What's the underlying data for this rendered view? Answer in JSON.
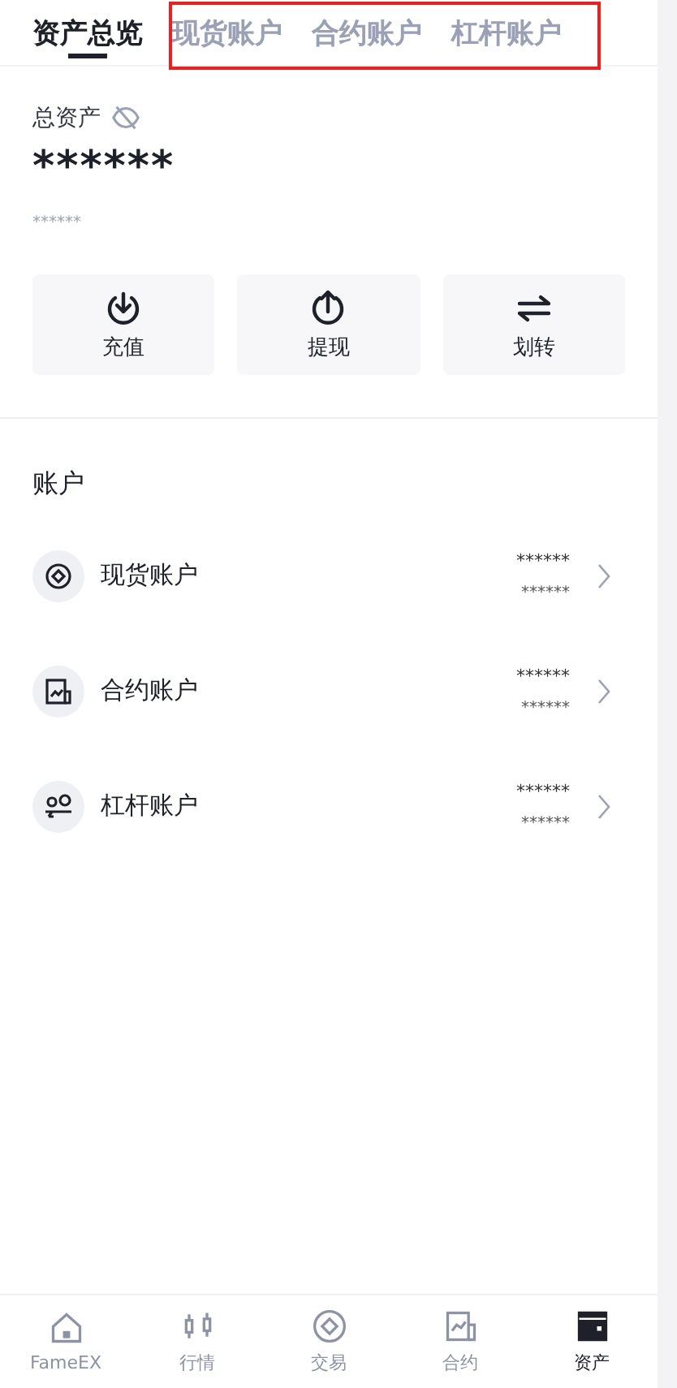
{
  "tabs": [
    {
      "label": "资产总览",
      "selected": true
    },
    {
      "label": "现货账户",
      "selected": false
    },
    {
      "label": "合约账户",
      "selected": false
    },
    {
      "label": "杠杆账户",
      "selected": false
    }
  ],
  "tabs_highlighted": true,
  "total": {
    "label": "总资产",
    "hidden": true,
    "value": "******",
    "sub_value": "******"
  },
  "actions": [
    {
      "kind": "deposit",
      "label": "充值"
    },
    {
      "kind": "withdraw",
      "label": "提现"
    },
    {
      "kind": "transfer",
      "label": "划转"
    }
  ],
  "accounts_title": "账户",
  "accounts": [
    {
      "kind": "spot",
      "name": "现货账户",
      "value": "******",
      "sub_value": "******"
    },
    {
      "kind": "futures",
      "name": "合约账户",
      "value": "******",
      "sub_value": "******"
    },
    {
      "kind": "margin",
      "name": "杠杆账户",
      "value": "******",
      "sub_value": "******"
    }
  ],
  "nav": [
    {
      "kind": "home",
      "label": "FameEX",
      "selected": false
    },
    {
      "kind": "market",
      "label": "行情",
      "selected": false
    },
    {
      "kind": "trade",
      "label": "交易",
      "selected": false
    },
    {
      "kind": "futures",
      "label": "合约",
      "selected": false
    },
    {
      "kind": "assets",
      "label": "资产",
      "selected": true
    }
  ]
}
